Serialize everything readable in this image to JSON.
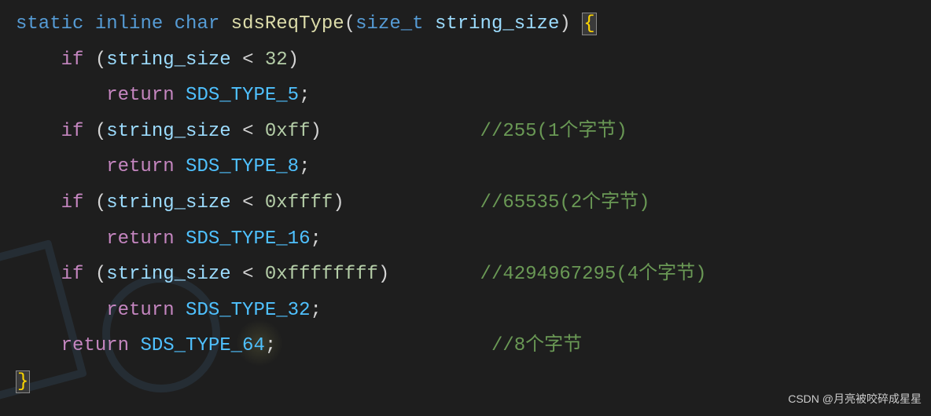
{
  "code": {
    "line1": {
      "static": "static",
      "inline": "inline",
      "char": "char",
      "funcName": "sdsReqType",
      "paramType": "size_t",
      "paramName": "string_size",
      "openBrace": "{"
    },
    "line2": {
      "if": "if",
      "var": "string_size",
      "op": "<",
      "num": "32"
    },
    "line3": {
      "return": "return",
      "const": "SDS_TYPE_5"
    },
    "line4": {
      "if": "if",
      "var": "string_size",
      "op": "<",
      "num": "0xff",
      "comment": "//255(1个字节)"
    },
    "line5": {
      "return": "return",
      "const": "SDS_TYPE_8"
    },
    "line6": {
      "if": "if",
      "var": "string_size",
      "op": "<",
      "num": "0xffff",
      "comment": "//65535(2个字节)"
    },
    "line7": {
      "return": "return",
      "const": "SDS_TYPE_16"
    },
    "line8": {
      "if": "if",
      "var": "string_size",
      "op": "<",
      "num": "0xffffffff",
      "comment": "//4294967295(4个字节)"
    },
    "line9": {
      "return": "return",
      "const": "SDS_TYPE_32"
    },
    "line10": {
      "return": "return",
      "const": "SDS_TYPE_64",
      "comment": "//8个字节"
    },
    "line11": {
      "closeBrace": "}"
    }
  },
  "watermark": "CSDN @月亮被咬碎成星星"
}
